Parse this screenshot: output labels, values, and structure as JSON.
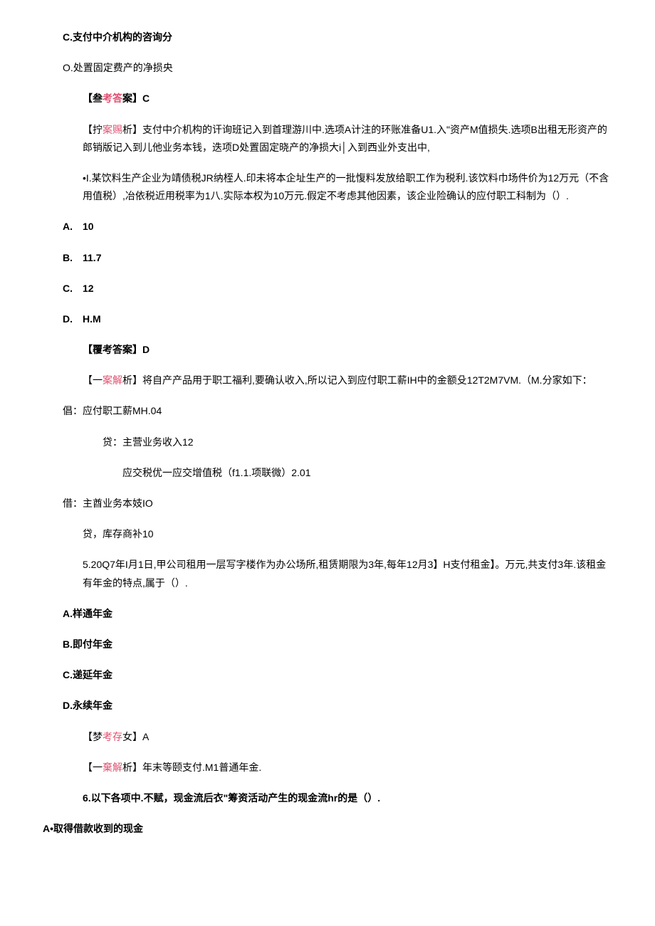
{
  "lines": [
    {
      "cls": "line indent-1 bold",
      "segments": [
        {
          "t": "C."
        },
        {
          "t": "支付中介机构的咨询分"
        }
      ]
    },
    {
      "cls": "line indent-1",
      "segments": [
        {
          "t": "O."
        },
        {
          "t": "处置固定费产的净损央"
        }
      ]
    },
    {
      "cls": "line indent-2 bold",
      "segments": [
        {
          "t": "【叁"
        },
        {
          "t": "考答",
          "h": true
        },
        {
          "t": "案】C"
        }
      ]
    },
    {
      "cls": "line indent-2",
      "segments": [
        {
          "t": "【拧"
        },
        {
          "t": "案赐",
          "h": true
        },
        {
          "t": "析】支付中介机构的讦询班记入到首理游川中.选项A计注的环账准备U1.入\"资产M值损失.选项B出租无形资产的郎销版记入到儿他业务本钱，迭项D处置固定晓产的净损大i│入到西业外支出中,"
        }
      ]
    },
    {
      "cls": "line indent-2",
      "segments": [
        {
          "t": "•I.某饮料生产企业为靖债税JR纳桎人.印未将本企址生产的一批愎料发放给职工作为税利.该饮料巾场件价为12万元（不含用值税）,冶依税近用税率为1八.实际本权为10万元.假定不考虑其他因素，该企业险确认的应付职工科制为（）."
        }
      ]
    },
    {
      "cls": "line indent-1 bold",
      "segments": [
        {
          "t": "A.　10"
        }
      ]
    },
    {
      "cls": "line indent-1 bold",
      "segments": [
        {
          "t": "B.　11.7"
        }
      ]
    },
    {
      "cls": "line indent-1 bold",
      "segments": [
        {
          "t": "C.　12"
        }
      ]
    },
    {
      "cls": "line indent-1 bold",
      "segments": [
        {
          "t": "D.　H.M"
        }
      ]
    },
    {
      "cls": "line indent-2 bold",
      "segments": [
        {
          "t": "【覆考答案】D"
        }
      ]
    },
    {
      "cls": "line indent-2",
      "segments": [
        {
          "t": "【一"
        },
        {
          "t": "案解",
          "h": true
        },
        {
          "t": "析】将自产产品用于职工福利,要确认收入,所以记入到应付职工薪IH中的金额殳12T2M7VM.（M.分家如下："
        }
      ]
    },
    {
      "cls": "line indent-1",
      "segments": [
        {
          "t": "倡：应付职工薪MH.04"
        }
      ]
    },
    {
      "cls": "line indent-3",
      "segments": [
        {
          "t": "贷：主营业务收入12"
        }
      ]
    },
    {
      "cls": "line indent-3",
      "segments": [
        {
          "t": "　　应交税优一应交增值税（f1.1.项联微）2.01"
        }
      ]
    },
    {
      "cls": "line indent-1",
      "segments": [
        {
          "t": "借：主酋业务本妓IO"
        }
      ]
    },
    {
      "cls": "line indent-2",
      "segments": [
        {
          "t": "贷，库存商补10"
        }
      ]
    },
    {
      "cls": "line indent-2",
      "segments": [
        {
          "t": "5.20Q7年I月1日,甲公司租用一层写字楼作为办公场所,租赁期限为3年,每年12月3】H支付租金】。万元,共支付3年.该租金有年金的特点,属于（）."
        }
      ]
    },
    {
      "cls": "line indent-1 bold",
      "segments": [
        {
          "t": "A."
        },
        {
          "t": "样通年金"
        }
      ]
    },
    {
      "cls": "line indent-1 bold",
      "segments": [
        {
          "t": "B."
        },
        {
          "t": "即付年金"
        }
      ]
    },
    {
      "cls": "line indent-1 bold",
      "segments": [
        {
          "t": "C."
        },
        {
          "t": "递延年金"
        }
      ]
    },
    {
      "cls": "line indent-1 bold",
      "segments": [
        {
          "t": "D."
        },
        {
          "t": "永续年金"
        }
      ]
    },
    {
      "cls": "line indent-2",
      "segments": [
        {
          "t": "【梦"
        },
        {
          "t": "考存",
          "h": true
        },
        {
          "t": "女】A"
        }
      ]
    },
    {
      "cls": "line indent-2",
      "segments": [
        {
          "t": "【一"
        },
        {
          "t": "棄解",
          "h": true
        },
        {
          "t": "析】年末等颐支付.M1普通年金."
        }
      ]
    },
    {
      "cls": "line indent-2 bold",
      "segments": [
        {
          "t": "6."
        },
        {
          "t": "以下各项中.不赋，现金流后衣\"筹资活动产生的现金流hr的是（）."
        }
      ]
    },
    {
      "cls": "line bold",
      "segments": [
        {
          "t": "A•取得借款收到的现金"
        }
      ]
    }
  ]
}
